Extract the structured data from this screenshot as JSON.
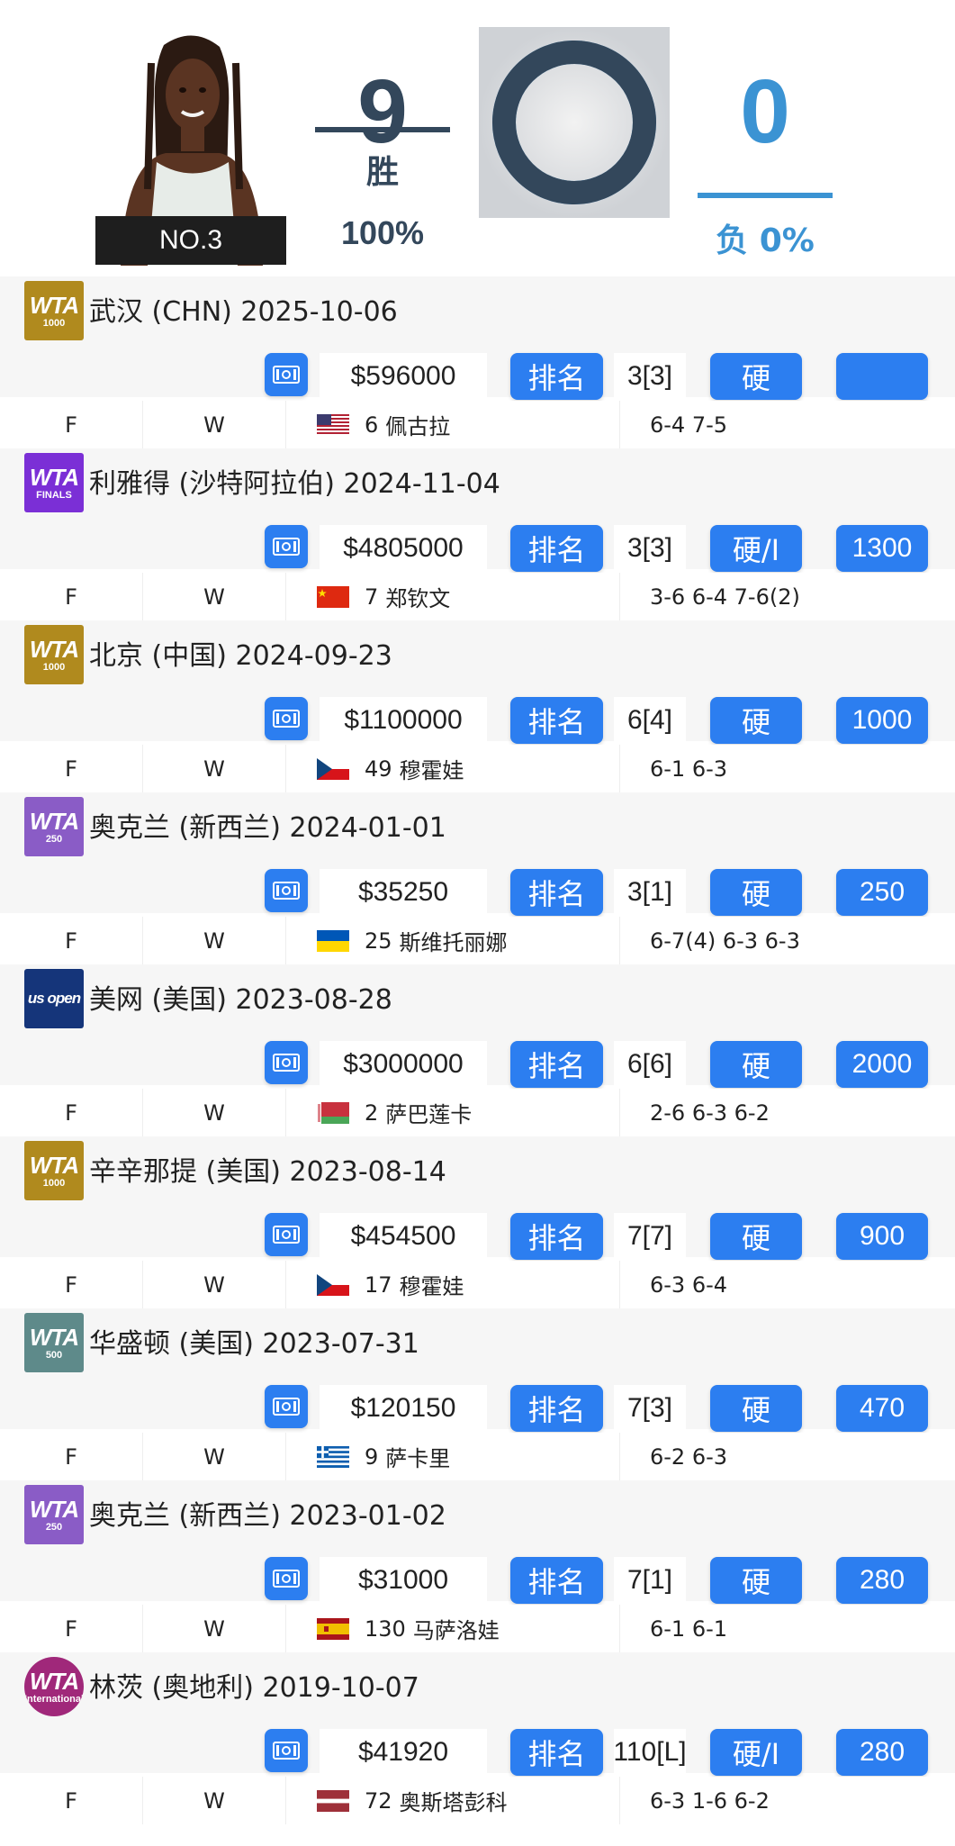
{
  "player": {
    "rank_label": "NO.3"
  },
  "summary": {
    "wins": "9",
    "wins_label": "胜",
    "wins_pct": "100%",
    "losses": "0",
    "losses_label": "负 0%",
    "win_fraction": 1.0
  },
  "colors": {
    "accent_blue": "#2c7ef0",
    "win_color": "#33475b",
    "loss_color": "#3b93d3"
  },
  "labels": {
    "rank_button": "排名"
  },
  "tournaments": [
    {
      "logo": {
        "type": "wta1000",
        "text": "WTA",
        "sub": "1000",
        "color": "#b08a1e"
      },
      "title": "武汉 (CHN) 2025-10-06",
      "prize": "$596000",
      "seed": "3[3]",
      "surface": "硬",
      "points": "",
      "match": {
        "round": "F",
        "result": "W",
        "flag": "us",
        "opp_rank": "6",
        "opponent": "佩古拉",
        "score": "6-4 7-5"
      }
    },
    {
      "logo": {
        "type": "finals",
        "text": "WTA",
        "sub": "FINALS",
        "color": "#7b2fd6"
      },
      "title": "利雅得 (沙特阿拉伯) 2024-11-04",
      "prize": "$4805000",
      "seed": "3[3]",
      "surface": "硬/I",
      "points": "1300",
      "match": {
        "round": "F",
        "result": "W",
        "flag": "cn",
        "opp_rank": "7",
        "opponent": "郑钦文",
        "score": "3-6 6-4 7-6(2)"
      }
    },
    {
      "logo": {
        "type": "wta1000",
        "text": "WTA",
        "sub": "1000",
        "color": "#b08a1e"
      },
      "title": "北京 (中国) 2024-09-23",
      "prize": "$1100000",
      "seed": "6[4]",
      "surface": "硬",
      "points": "1000",
      "match": {
        "round": "F",
        "result": "W",
        "flag": "cz",
        "opp_rank": "49",
        "opponent": "穆霍娃",
        "score": "6-1 6-3"
      }
    },
    {
      "logo": {
        "type": "wta250",
        "text": "WTA",
        "sub": "250",
        "color": "#8a5cc6"
      },
      "title": "奥克兰 (新西兰) 2024-01-01",
      "prize": "$35250",
      "seed": "3[1]",
      "surface": "硬",
      "points": "250",
      "match": {
        "round": "F",
        "result": "W",
        "flag": "ua",
        "opp_rank": "25",
        "opponent": "斯维托丽娜",
        "score": "6-7(4) 6-3 6-3"
      }
    },
    {
      "logo": {
        "type": "usopen",
        "text": "us open",
        "sub": "",
        "color": "#15357a"
      },
      "title": "美网 (美国) 2023-08-28",
      "prize": "$3000000",
      "seed": "6[6]",
      "surface": "硬",
      "points": "2000",
      "match": {
        "round": "F",
        "result": "W",
        "flag": "by",
        "opp_rank": "2",
        "opponent": "萨巴莲卡",
        "score": "2-6 6-3 6-2"
      }
    },
    {
      "logo": {
        "type": "wta1000",
        "text": "WTA",
        "sub": "1000",
        "color": "#b08a1e"
      },
      "title": "辛辛那提 (美国) 2023-08-14",
      "prize": "$454500",
      "seed": "7[7]",
      "surface": "硬",
      "points": "900",
      "match": {
        "round": "F",
        "result": "W",
        "flag": "cz",
        "opp_rank": "17",
        "opponent": "穆霍娃",
        "score": "6-3 6-4"
      }
    },
    {
      "logo": {
        "type": "wta500",
        "text": "WTA",
        "sub": "500",
        "color": "#5e8a8a"
      },
      "title": "华盛顿 (美国) 2023-07-31",
      "prize": "$120150",
      "seed": "7[3]",
      "surface": "硬",
      "points": "470",
      "match": {
        "round": "F",
        "result": "W",
        "flag": "gr",
        "opp_rank": "9",
        "opponent": "萨卡里",
        "score": "6-2 6-3"
      }
    },
    {
      "logo": {
        "type": "wta250",
        "text": "WTA",
        "sub": "250",
        "color": "#8a5cc6"
      },
      "title": "奥克兰 (新西兰) 2023-01-02",
      "prize": "$31000",
      "seed": "7[1]",
      "surface": "硬",
      "points": "280",
      "match": {
        "round": "F",
        "result": "W",
        "flag": "es",
        "opp_rank": "130",
        "opponent": "马萨洛娃",
        "score": "6-1 6-1"
      }
    },
    {
      "logo": {
        "type": "international",
        "text": "WTA",
        "sub": "International",
        "color": "#a0287a"
      },
      "title": "林茨 (奥地利) 2019-10-07",
      "prize": "$41920",
      "seed": "110[L]",
      "surface": "硬/I",
      "points": "280",
      "match": {
        "round": "F",
        "result": "W",
        "flag": "lv",
        "opp_rank": "72",
        "opponent": "奥斯塔彭科",
        "score": "6-3 1-6 6-2"
      }
    }
  ]
}
